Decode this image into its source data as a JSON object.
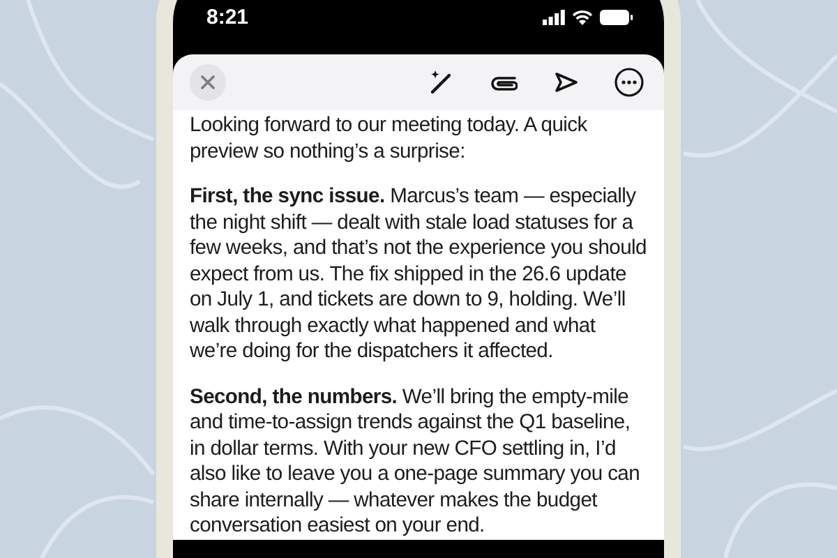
{
  "status_bar": {
    "time": "8:21"
  },
  "toolbar": {
    "buttons": [
      {
        "kind": "close"
      },
      {
        "kind": "wand"
      },
      {
        "kind": "attach"
      },
      {
        "kind": "send"
      },
      {
        "kind": "more"
      }
    ]
  },
  "message": {
    "paragraphs": [
      "Looking forward to our meeting today. A quick preview so nothing’s a surprise:",
      "**First, the sync issue.** Marcus’s team — especially the night shift — dealt with stale load statuses for a few weeks, and that’s not the experience you should expect from us. The fix shipped in the 26.6 update on July 1, and tickets are down to 9, holding. We’ll walk through exactly what happened and what we’re doing for the dispatchers it affected.",
      "**Second, the numbers.** We’ll bring the empty-mile and time-to-assign trends against the Q1 baseline, in dollar terms. With your new CFO settling in, I’d also like to leave you a one-page summary you can share internally — whatever makes the budget conversation easiest on your end."
    ]
  }
}
